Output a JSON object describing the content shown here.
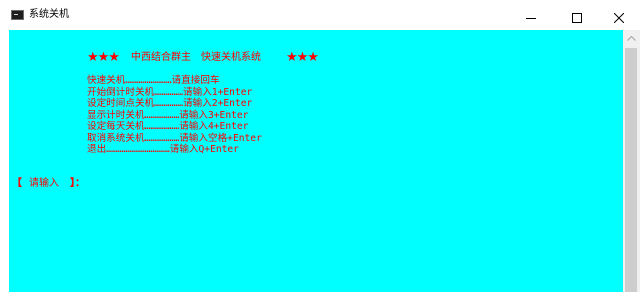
{
  "window": {
    "title": "系统关机"
  },
  "console": {
    "heading": {
      "stars_left": "★★★",
      "title": "中西结合群主　快速关机系统",
      "stars_right": "★★★"
    },
    "menu": [
      {
        "label": "快速关机……………………",
        "action": "请直接回车"
      },
      {
        "label": "开始倒计时关机……………",
        "action": "请输入1+Enter"
      },
      {
        "label": "设定时间点关机……………",
        "action": "请输入2+Enter"
      },
      {
        "label": "显示计时关机………………",
        "action": "请输入3+Enter"
      },
      {
        "label": "设定每天关机………………",
        "action": "请输入4+Enter"
      },
      {
        "label": "取消系统关机………………",
        "action": "请输入空格+Enter"
      },
      {
        "label": "退出……………………………",
        "action": "请输入Q+Enter"
      }
    ],
    "prompt": {
      "open_bracket": "【",
      "label": "请输入",
      "close_bracket": "】：",
      "value": ""
    }
  },
  "colors": {
    "console_background": "#00ffff",
    "console_text": "#ff0000"
  },
  "icons": {
    "app": "console-app-icon",
    "minimize": "minimize-icon",
    "maximize": "maximize-icon",
    "close": "close-icon",
    "scroll_up": "scroll-up-arrow-icon"
  }
}
